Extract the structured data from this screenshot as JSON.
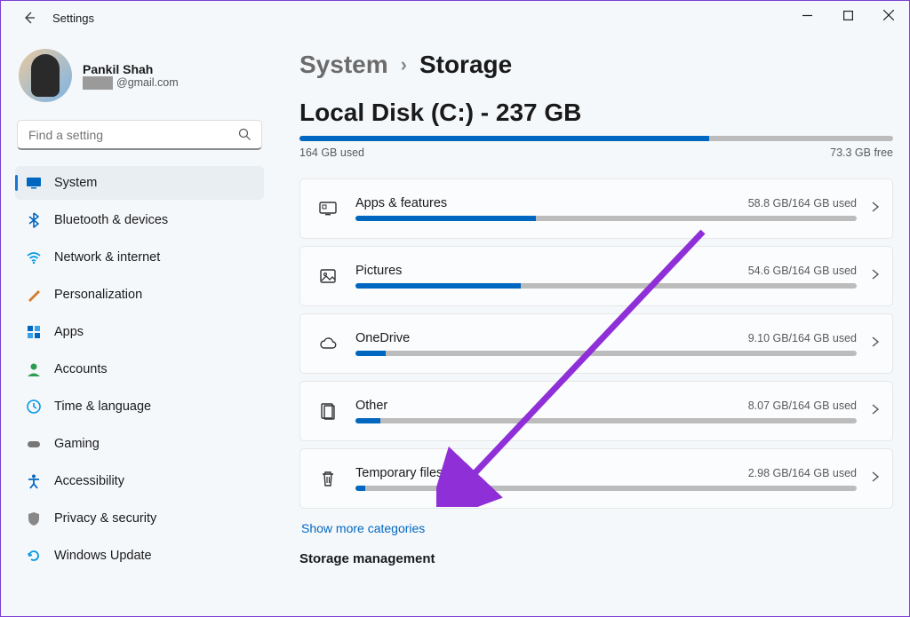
{
  "window": {
    "title": "Settings"
  },
  "profile": {
    "name": "Pankil Shah",
    "email_suffix": "@gmail.com"
  },
  "search": {
    "placeholder": "Find a setting"
  },
  "nav": [
    {
      "icon": "monitor",
      "label": "System",
      "active": true,
      "color": "#0067c0"
    },
    {
      "icon": "bluetooth",
      "label": "Bluetooth & devices",
      "active": false,
      "color": "#0067c0"
    },
    {
      "icon": "wifi",
      "label": "Network & internet",
      "active": false,
      "color": "#0099e5"
    },
    {
      "icon": "brush",
      "label": "Personalization",
      "active": false,
      "color": "#d67b2c"
    },
    {
      "icon": "grid",
      "label": "Apps",
      "active": false,
      "color": "#0067c0"
    },
    {
      "icon": "person",
      "label": "Accounts",
      "active": false,
      "color": "#2e9b4f"
    },
    {
      "icon": "clock",
      "label": "Time & language",
      "active": false,
      "color": "#0099e5"
    },
    {
      "icon": "gamepad",
      "label": "Gaming",
      "active": false,
      "color": "#777"
    },
    {
      "icon": "accessibility",
      "label": "Accessibility",
      "active": false,
      "color": "#0067c0"
    },
    {
      "icon": "shield",
      "label": "Privacy & security",
      "active": false,
      "color": "#888"
    },
    {
      "icon": "update",
      "label": "Windows Update",
      "active": false,
      "color": "#0099e5"
    }
  ],
  "breadcrumb": {
    "parent": "System",
    "current": "Storage"
  },
  "disk": {
    "title": "Local Disk (C:) - 237 GB",
    "used_label": "164 GB used",
    "free_label": "73.3 GB free",
    "used_pct": 69
  },
  "categories": [
    {
      "icon": "apps",
      "name": "Apps & features",
      "used_label": "58.8 GB/164 GB used",
      "pct": 36
    },
    {
      "icon": "pictures",
      "name": "Pictures",
      "used_label": "54.6 GB/164 GB used",
      "pct": 33
    },
    {
      "icon": "cloud",
      "name": "OneDrive",
      "used_label": "9.10 GB/164 GB used",
      "pct": 6
    },
    {
      "icon": "other",
      "name": "Other",
      "used_label": "8.07 GB/164 GB used",
      "pct": 5
    },
    {
      "icon": "trash",
      "name": "Temporary files",
      "used_label": "2.98 GB/164 GB used",
      "pct": 2
    }
  ],
  "show_more": "Show more categories",
  "section_storage_mgmt": "Storage management"
}
